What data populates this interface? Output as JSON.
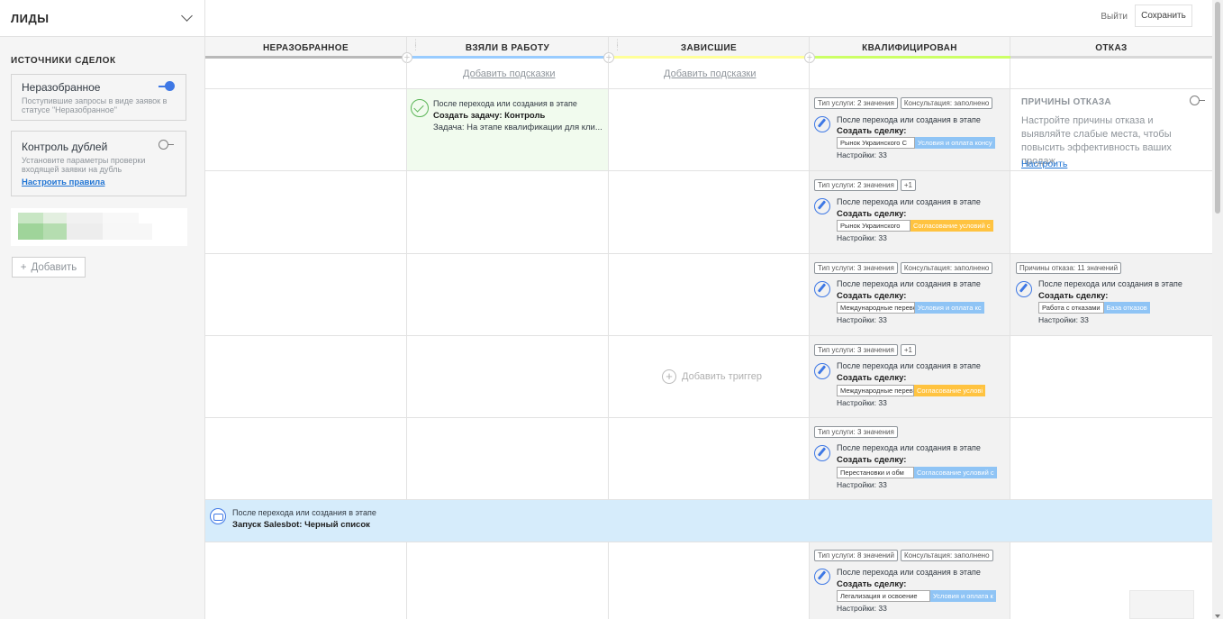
{
  "pipeline": {
    "title": "ЛИДЫ"
  },
  "left_panel": {
    "sources_title": "ИСТОЧНИКИ СДЕЛОК",
    "cards": [
      {
        "title": "Неразобранное",
        "desc": "Поступившие запросы в виде заявок в статусе \"Неразобранное\"",
        "toggle": "on"
      },
      {
        "title": "Контроль дублей",
        "desc": "Установите параметры проверки входящей заявки на дубль",
        "link": "Настроить правила",
        "toggle": "off"
      }
    ],
    "add_button": "Добавить"
  },
  "topbar": {
    "exit": "Выйти",
    "save": "Сохранить"
  },
  "columns": [
    {
      "name": "НЕРАЗОБРАННОЕ",
      "color": "#b9b9b9",
      "hint": ""
    },
    {
      "name": "ВЗЯЛИ В РАБОТУ",
      "color": "#99ccff",
      "hint": "Добавить подсказки"
    },
    {
      "name": "ЗАВИСШИЕ",
      "color": "#ffff99",
      "hint": "Добавить подсказки"
    },
    {
      "name": "КВАЛИФИЦИРОВАН",
      "color": "#ccff66",
      "hint": ""
    },
    {
      "name": "ОТКАЗ",
      "color": "#d8d8d8",
      "hint": ""
    }
  ],
  "task_trigger": {
    "line1": "После перехода или создания в этапе",
    "line2": "Создать задачу: Контроль",
    "line3": "Задача: На этапе квалификации для кли..."
  },
  "refusal": {
    "title": "ПРИЧИНЫ ОТКАЗА",
    "text": "Настройте причины отказа и выявляйте слабые места, чтобы повысить эффективность ваших продаж",
    "link": "Настроить"
  },
  "common": {
    "after_transition": "После перехода или создания в этапе",
    "create_deal": "Создать сделку:",
    "settings": "Настройки: 33",
    "add_trigger": "Добавить триггер"
  },
  "qual_rows": [
    {
      "tags": [
        "Тип услуги: 2 значения",
        "Консультация: заполнено"
      ],
      "pill_left": "Рынок Украинского С",
      "pill_right": "Условия и оплата консу",
      "pill_color": "#8fc4f5"
    },
    {
      "tags": [
        "Тип услуги: 2 значения",
        "+1"
      ],
      "pill_left": "Рынок Украинского",
      "pill_right": "Согласование условий с",
      "pill_color": "#ffc340"
    },
    {
      "tags": [
        "Тип услуги: 3 значения",
        "Консультация: заполнено"
      ],
      "pill_left": "Международные перевс",
      "pill_right": "Условия и оплата кс",
      "pill_color": "#8fc4f5"
    },
    {
      "tags": [
        "Тип услуги: 3 значения",
        "+1"
      ],
      "pill_left": "Международные перев",
      "pill_right": "Согласование услові",
      "pill_color": "#ffc340"
    },
    {
      "tags": [
        "Тип услуги: 3 значения"
      ],
      "pill_left": "Перестановки и обм",
      "pill_right": "Согласование условий с",
      "pill_color": "#8fc4f5"
    },
    {
      "tags": [
        "Тип услуги: 8 значений",
        "Консультация: заполнено"
      ],
      "pill_left": "Легализация и освоение",
      "pill_right": "Условия и оплата к",
      "pill_color": "#8fc4f5"
    }
  ],
  "refusal_row": {
    "tag": "Причины отказа: 11 значений",
    "pill_left": "Работа с отказами",
    "pill_right": "База отказов",
    "pill_color": "#8fc4f5"
  },
  "salesbot": {
    "line1": "После перехода или создания в этапе",
    "line2": "Запуск Salesbot: Черный список"
  }
}
